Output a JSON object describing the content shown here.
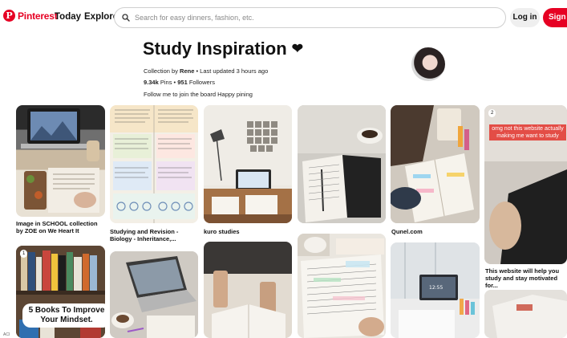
{
  "header": {
    "logo_text": "Pinterest",
    "nav_today": "Today",
    "nav_explore": "Explore",
    "search_placeholder": "Search for easy dinners, fashion, etc.",
    "login_label": "Log in",
    "signup_label": "Sign up"
  },
  "board": {
    "title": "Study Inspiration",
    "title_icon": "heart-icon",
    "collection_by_prefix": "Collection by ",
    "owner": "Rene",
    "updated": " • Last updated 3 hours ago",
    "pins_count": "9.34k",
    "pins_label": " Pins • ",
    "followers_count": "951",
    "followers_label": " Followers",
    "description": "Follow me to join the board Happy pining"
  },
  "pins": [
    {
      "caption": "Image in SCHOOL collection by ZOE on We Heart It"
    },
    {
      "caption": "Studying and Revision - Biology - Inheritance,..."
    },
    {
      "caption": "kuro studies"
    },
    {
      "caption": ""
    },
    {
      "caption": "Qunel.com"
    },
    {
      "caption": "This website will help you study and stay motivated for...",
      "badge": "2",
      "overlay": "omg not this website actually making me want to study"
    },
    {
      "caption": "",
      "badge": "1",
      "overlay": "5 Books To Improve Your Mindset."
    },
    {
      "caption": ""
    },
    {
      "caption": ""
    },
    {
      "caption": ""
    },
    {
      "caption": ""
    },
    {
      "caption": ""
    }
  ],
  "colors": {
    "brand": "#e60023",
    "page_background": "#e2e9f7",
    "overlay_red": "#e34d46"
  }
}
